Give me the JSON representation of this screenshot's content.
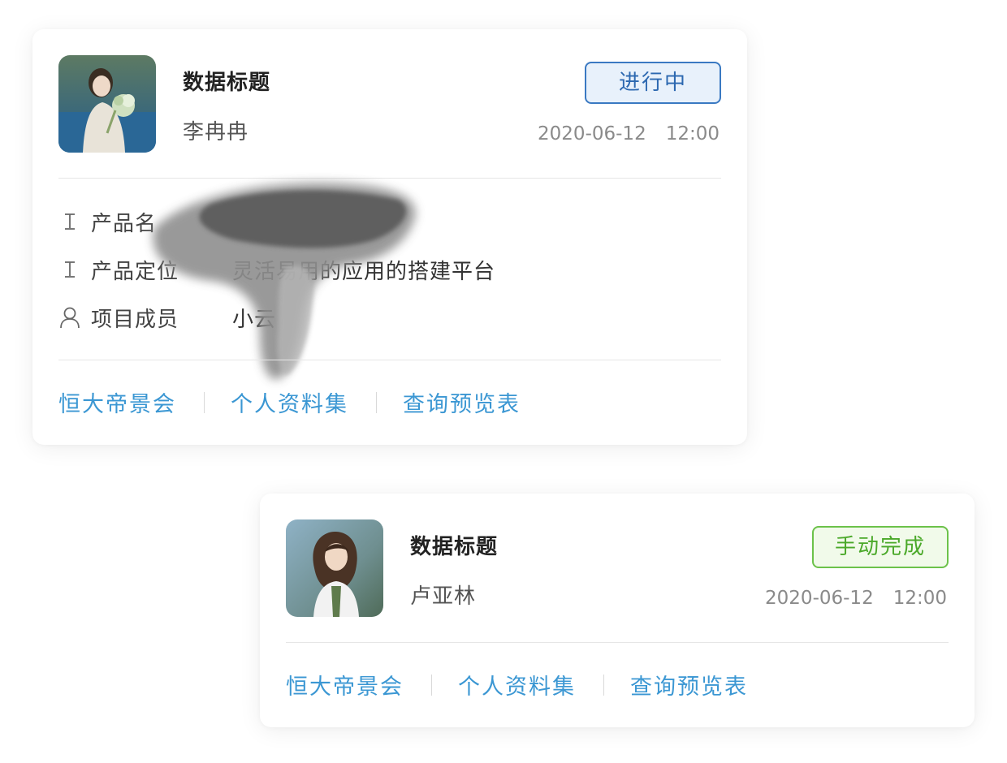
{
  "cards": [
    {
      "title": "数据标题",
      "person": "李冉冉",
      "status": "进行中",
      "status_color": "#2c68b0",
      "date": "2020-06-12",
      "time": "12:00",
      "fields": [
        {
          "icon": "text-icon",
          "label": "产品名",
          "value": ""
        },
        {
          "icon": "text-icon",
          "label": "产品定位",
          "value": "灵活易用的应用的搭建平台"
        },
        {
          "icon": "user-icon",
          "label": "项目成员",
          "value": "小云"
        }
      ],
      "links": [
        "恒大帝景会",
        "个人资料集",
        "查询预览表"
      ]
    },
    {
      "title": "数据标题",
      "person": "卢亚林",
      "status": "手动完成",
      "status_color": "#4ba92a",
      "date": "2020-06-12",
      "time": "12:00",
      "links": [
        "恒大帝景会",
        "个人资料集",
        "查询预览表"
      ]
    }
  ],
  "colors": {
    "link": "#3b97d3",
    "divider": "#e6e6e6"
  }
}
